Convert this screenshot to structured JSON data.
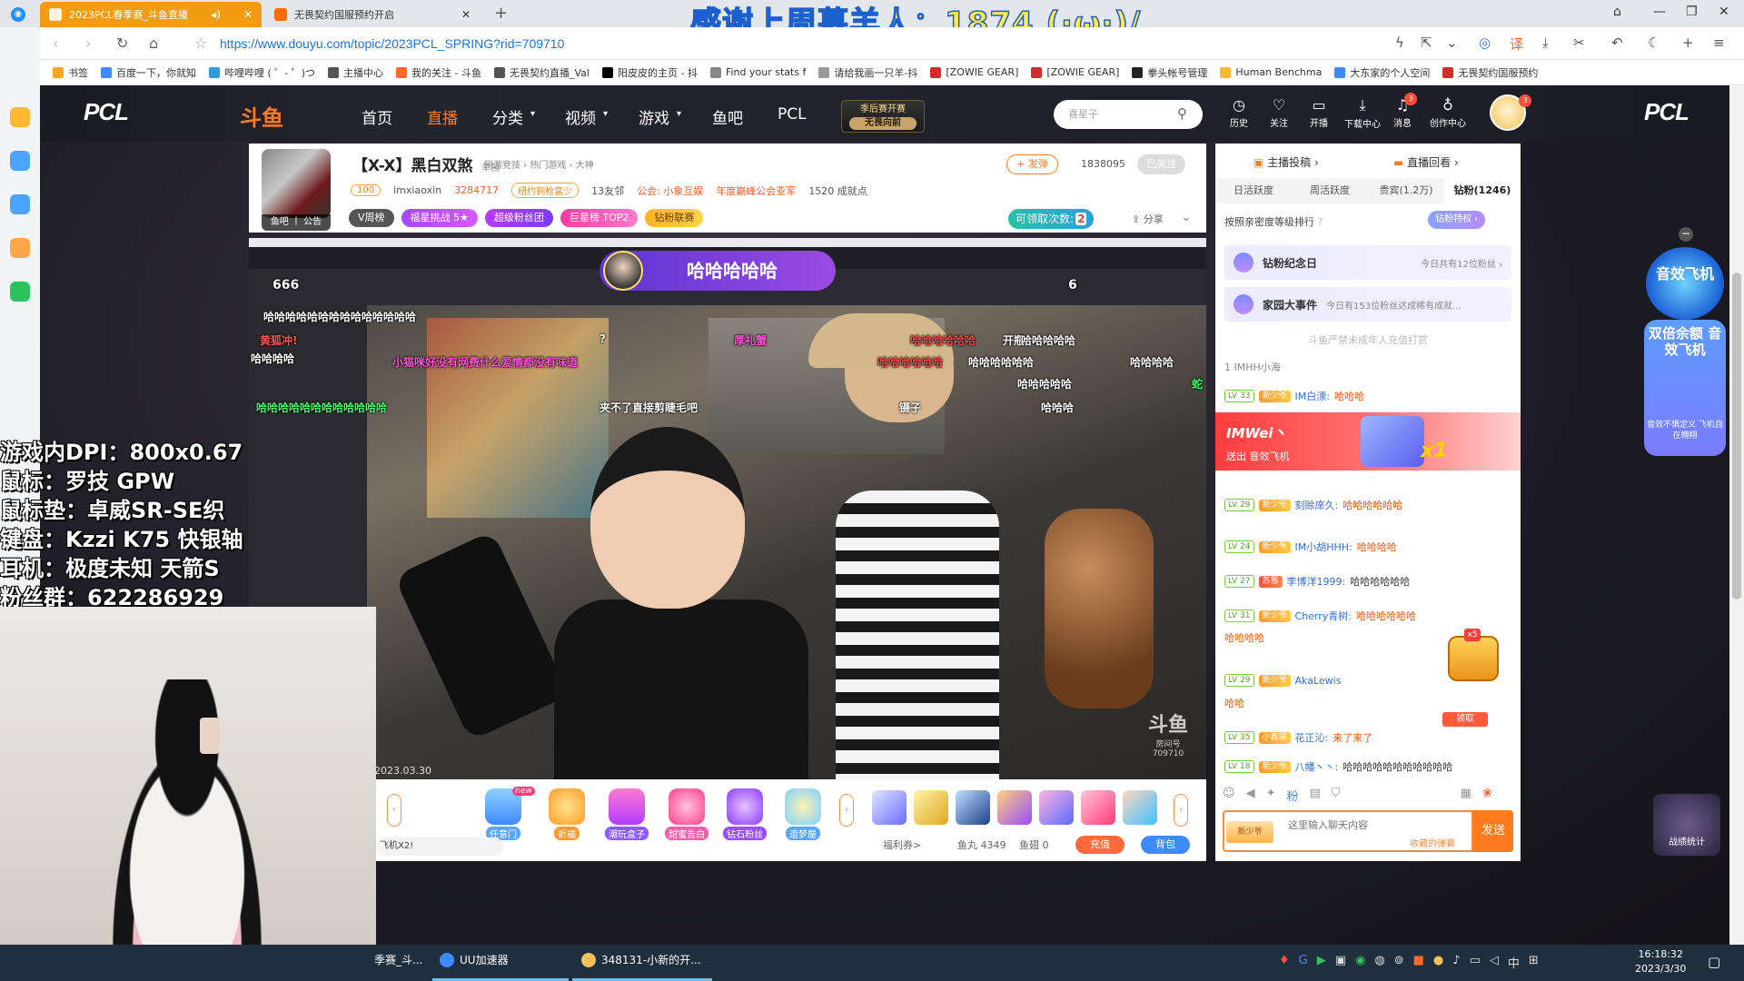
{
  "browser": {
    "tabs": [
      {
        "label": "2023PCL春季赛_斗鱼直播",
        "active": true
      },
      {
        "label": "无畏契约国服预约开启",
        "active": false
      }
    ],
    "banner": "感谢上周慕羊人：1874 (·ω·)/",
    "url": "https://www.douyu.com/topic/2023PCL_SPRING?rid=709710",
    "bookmarks": [
      "书签",
      "百度一下，你就知",
      "哔哩哔哩 ( ゜- ゜)つ",
      "主播中心",
      "我的关注 - 斗鱼",
      "无畏契约直播_Val",
      "阳皮皮的主页 - 抖",
      "Find your stats f",
      "请给我画一只羊-抖",
      "[ZOWIE GEAR]",
      "[ZOWIE GEAR]",
      "拳头帐号管理",
      "Human Benchma",
      "大东家的个人空间",
      "无畏契约国服预约"
    ]
  },
  "site": {
    "pcl_logo": "PCL",
    "douyu_logo": "斗鱼",
    "nav": [
      "首页",
      "直播",
      "分类",
      "视频",
      "游戏",
      "鱼吧",
      "PCL"
    ],
    "nav_active": "直播",
    "season_badge": {
      "title": "季后赛开赛",
      "sub": "无畏向前"
    },
    "search_placeholder": "喜星子",
    "actions": [
      "历史",
      "关注",
      "开播",
      "下载中心",
      "消息",
      "创作中心"
    ],
    "msg_count": "3",
    "avatar_count": "3"
  },
  "streamer": {
    "title": "【X-X】黑白双煞",
    "report": "举报",
    "breadcrumb": "网游竞技 › 热门游戏 › 大神",
    "avatar_tag": "鱼吧 丨 公告",
    "level": "100",
    "name": "imxiaoxin",
    "hot": "3284717",
    "pill_copper": "纽约铜枪富少",
    "friends": "13友邻",
    "guild": "公会: 小象互娱",
    "peak": "年度巅峰公会亚军",
    "achievement": "1520 成就点",
    "week_rank": "V周榜",
    "welfare": "福星挑战 5★",
    "super_fans": "超级粉丝团",
    "giant_star": "巨星榜 TOP2",
    "diamond": "钻粉联赛",
    "follow_btn": "+ 发弹",
    "follow_count": "1838095",
    "followed": "已关注",
    "claim": "可领取次数:",
    "claim_count": "2",
    "share": "分享"
  },
  "video": {
    "banner": "哈哈哈哈哈",
    "banner_left": "666",
    "banner_right": "6",
    "date": "2023.03.30",
    "room_watermark": "斗鱼",
    "room_label": "房间号",
    "room_id": "709710",
    "danmu": [
      {
        "text": "哈哈哈哈哈哈哈哈哈哈哈哈哈哈",
        "color": "#ffffff"
      },
      {
        "text": "黄狐冲!",
        "color": "#ff5252"
      },
      {
        "text": "哈哈哈哈",
        "color": "#ffffff"
      },
      {
        "text": "小猫咪好没有网费什么爱情都没有味道",
        "color": "#ff4fd8"
      },
      {
        "text": "哈哈哈哈哈哈哈哈哈哈哈哈",
        "color": "#33ff66"
      },
      {
        "text": "夹不了直接剪睫毛吧",
        "color": "#ffffff"
      },
      {
        "text": "镊子",
        "color": "#ffffff"
      },
      {
        "text": "开瓶",
        "color": "#ffffff"
      },
      {
        "text": "哈哈哈哈",
        "color": "#ffffff"
      },
      {
        "text": "哈哈哈哈哈",
        "color": "#ffffff"
      },
      {
        "text": "哈哈哈",
        "color": "#ffffff"
      },
      {
        "text": "哈哈哈哈哈哈",
        "color": "#ff4444"
      },
      {
        "text": "哈哈哈哈哈",
        "color": "#ffffff"
      },
      {
        "text": "厚礼蟹",
        "color": "#ff4fd8"
      },
      {
        "text": "哈哈哈哈哈哈",
        "color": "#ff4444"
      },
      {
        "text": "哈哈哈哈哈哈",
        "color": "#ffffff"
      },
      {
        "text": "?",
        "color": "#ffffff"
      },
      {
        "text": "蛇",
        "color": "#33ff66"
      }
    ]
  },
  "overlay_specs": [
    "游戏内DPI：800x0.67",
    "鼠标：罗技 GPW",
    "鼠标垫：卓威SR-SE织",
    "键盘：Kzzi K75 快银轴",
    "耳机：极度未知 天箭S",
    "粉丝群：622286929"
  ],
  "player_bar": {
    "gifts": [
      "任意门",
      "祈福",
      "潮玩盒子",
      "甜蜜告白",
      "钻石粉丝",
      "造梦屋"
    ],
    "new_tag": "new",
    "tip": "飞机X2!",
    "welfare": "福利券>",
    "fish_ball": "鱼丸 4349",
    "fish_fin": "鱼翅 0",
    "charge": "充值",
    "bag": "背包"
  },
  "chat": {
    "top_tabs": [
      "主播投稿 ›",
      "直播回看 ›"
    ],
    "rank_tabs": [
      "日活跃度",
      "周活跃度",
      "贵宾(1.2万)",
      "钻粉(1246)"
    ],
    "rank_active": "钻粉(1246)",
    "rank_desc": "按照亲密度等级排行",
    "privilege": "钻粉特权 ›",
    "promos": [
      {
        "title": "钻粉纪念日",
        "right": "今日共有12位粉丝 ›"
      },
      {
        "title": "家园大事件",
        "right": "今日有153位粉丝达成稀有成就..."
      }
    ],
    "notice": "斗鱼严禁未成年人充值打赏",
    "first_user": "1  IMHH小海",
    "gift_banner": {
      "name": "IMWei丶",
      "sub": "送出  音效飞机",
      "count": "x1"
    },
    "messages": [
      {
        "lv": "LV 33",
        "badge": "新少爷",
        "user": "IM白漂:",
        "msg": "哈哈哈",
        "msgColor": "#ff4e00"
      },
      {
        "lv": "LV 29",
        "badge": "新少爷",
        "user": "刻赊庠久:",
        "msg": "哈哈哈哈哈哈",
        "msgColor": "#ff4e00"
      },
      {
        "lv": "LV 24",
        "badge": "新少爷",
        "user": "IM小胡HHH:",
        "msg": "哈哈哈哈",
        "msgColor": "#ff4e00"
      },
      {
        "lv": "LV 27",
        "badge": "苏恩",
        "user": "李博洋1999:",
        "msg": "哈哈哈哈哈哈",
        "msgColor": "#333333"
      },
      {
        "lv": "LV 31",
        "badge": "新少爷",
        "user": "Cherry青树:",
        "msg": "哈哈哈哈哈哈",
        "msgColor": "#ff4e00"
      },
      {
        "lv": "",
        "badge": "",
        "user": "",
        "msg": "哈哈哈哈",
        "msgColor": "#ff4e00"
      },
      {
        "lv": "LV 29",
        "badge": "新少爷",
        "user": "AkaLewis",
        "msg": "",
        "msgColor": "#ff4e00"
      },
      {
        "lv": "",
        "badge": "",
        "user": "",
        "msg": "哈哈",
        "msgColor": "#ff4e00"
      },
      {
        "lv": "LV 35",
        "badge": "小鑫猫",
        "user": "花正沁:",
        "msg": "来了来了",
        "msgColor": "#ff4e00"
      },
      {
        "lv": "LV 18",
        "badge": "新少爷",
        "user": "八幡丶丶:",
        "msg": "哈哈哈哈哈哈哈哈哈哈哈",
        "msgColor": "#333333"
      }
    ],
    "chest_count": "x5",
    "chest_claim": "领取",
    "input_placeholder": "这里输入聊天内容",
    "input_hint": "收藏的弹幕",
    "input_badge": "新少爷",
    "send": "发送"
  },
  "floating": {
    "badge1": "音效飞机",
    "badge2_title": "双倍余额 音效飞机",
    "badge2_sub": "音效不惧定义 飞机自在翱翔",
    "battle": "战绩统计"
  },
  "taskbar": {
    "items": [
      "季赛_斗...",
      "UU加速器",
      "348131-小新的开..."
    ],
    "time": "16:18:32",
    "date": "2023/3/30",
    "ime": "中"
  }
}
